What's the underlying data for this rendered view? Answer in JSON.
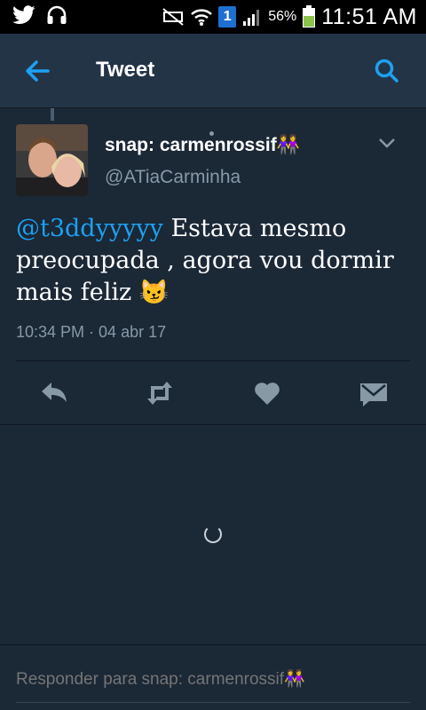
{
  "status_bar": {
    "notification_badge": "1",
    "battery_percent": "56%",
    "time": "11:51 AM"
  },
  "app_bar": {
    "title": "Tweet"
  },
  "tweet": {
    "display_name": "snap: carmenrossif👭",
    "handle": "@ATiaCarminha",
    "mention": "@t3ddyyyyy",
    "text": " Estava mesmo preocupada , agora vou dormir mais feliz 😼",
    "timestamp": "10:34 PM · 04 abr 17"
  },
  "reply": {
    "placeholder": "Responder para snap: carmenrossif👭"
  },
  "colors": {
    "accent": "#1da1f2",
    "background": "#1b2836",
    "app_bar": "#243447",
    "secondary_text": "#8899a6"
  },
  "icons": [
    "twitter-icon",
    "headphones-icon",
    "mute-icon",
    "wifi-icon",
    "signal-icon",
    "battery-icon",
    "back-arrow-icon",
    "search-icon",
    "chevron-down-icon",
    "reply-icon",
    "retweet-icon",
    "like-icon",
    "direct-message-icon"
  ]
}
